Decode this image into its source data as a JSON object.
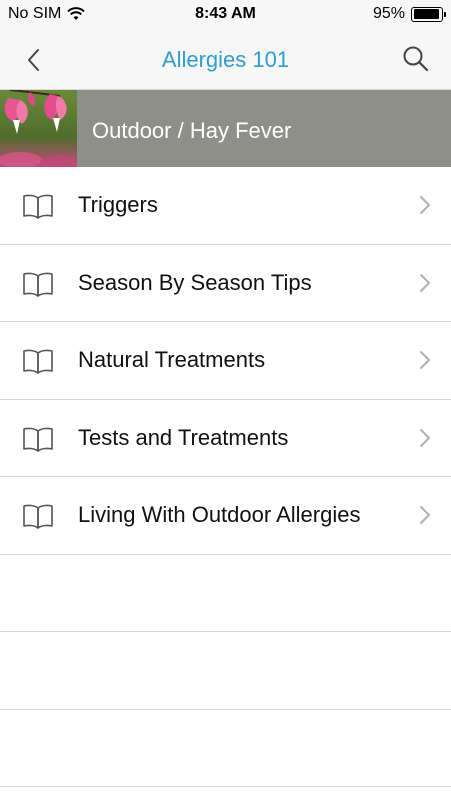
{
  "status_bar": {
    "carrier": "No SIM",
    "time": "8:43 AM",
    "battery_percent": "95%",
    "battery_level": 0.95
  },
  "nav": {
    "title": "Allergies 101",
    "back_icon": "chevron-left-icon",
    "search_icon": "search-icon"
  },
  "header": {
    "title": "Outdoor / Hay Fever",
    "thumbnail": "bleeding-heart-flower-photo"
  },
  "topics": [
    {
      "label": "Triggers",
      "icon": "book-icon"
    },
    {
      "label": "Season By Season Tips",
      "icon": "book-icon"
    },
    {
      "label": "Natural Treatments",
      "icon": "book-icon"
    },
    {
      "label": "Tests and Treatments",
      "icon": "book-icon"
    },
    {
      "label": "Living With Outdoor Allergies",
      "icon": "book-icon"
    }
  ],
  "colors": {
    "accent": "#2a9fd6",
    "banner_bg": "#8f8f8a"
  }
}
